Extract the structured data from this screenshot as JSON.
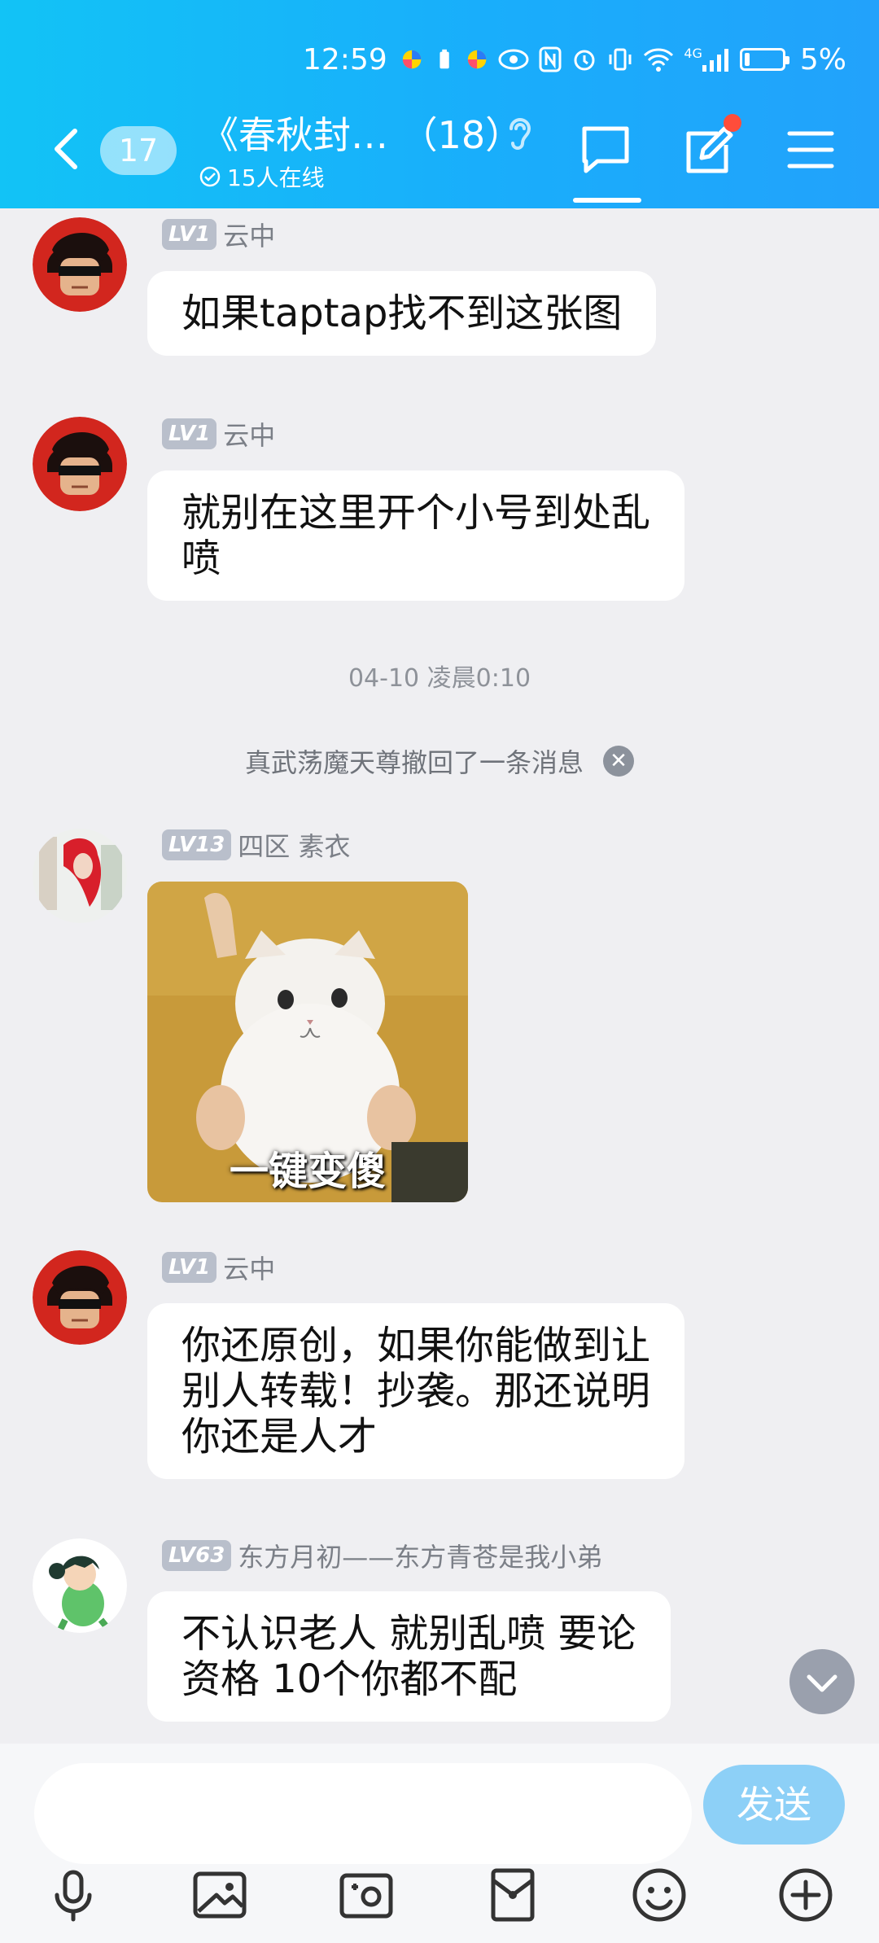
{
  "status_bar": {
    "time": "12:59",
    "network": "4G",
    "battery": "5%"
  },
  "header": {
    "unread_count": "17",
    "title": "《春秋封…  （18）",
    "online": "15人在线"
  },
  "messages": [
    {
      "level": "LV1",
      "name": "云中",
      "text": "如果taptap找不到这张图"
    },
    {
      "level": "LV1",
      "name": "云中",
      "text_line1": "就别在这里开个小号到处乱",
      "text_line2": "喷"
    },
    {
      "timestamp": "04-10 凌晨0:10"
    },
    {
      "recall": "真武荡魔天尊撤回了一条消息"
    },
    {
      "level": "LV13",
      "name": "四区 素衣",
      "sticker_caption": "一键变傻"
    },
    {
      "level": "LV1",
      "name": "云中",
      "text_line1": "你还原创，如果你能做到让",
      "text_line2": "别人转载！抄袭。那还说明",
      "text_line3": "你还是人才"
    },
    {
      "level": "LV63",
      "name": "东方月初——东方青苍是我小弟",
      "text_line1": "不认识老人  就别乱喷  要论",
      "text_line2": "资格  10个你都不配"
    }
  ],
  "composer": {
    "send_label": "发送",
    "tools": [
      "microphone-icon",
      "image-icon",
      "camera-icon",
      "red-packet-icon",
      "emoji-icon",
      "plus-icon"
    ]
  },
  "colors": {
    "header_start": "#12c3f6",
    "header_end": "#22a2fb",
    "send_button": "#8dd0f7",
    "unread_dot": "#ff4d3a"
  }
}
